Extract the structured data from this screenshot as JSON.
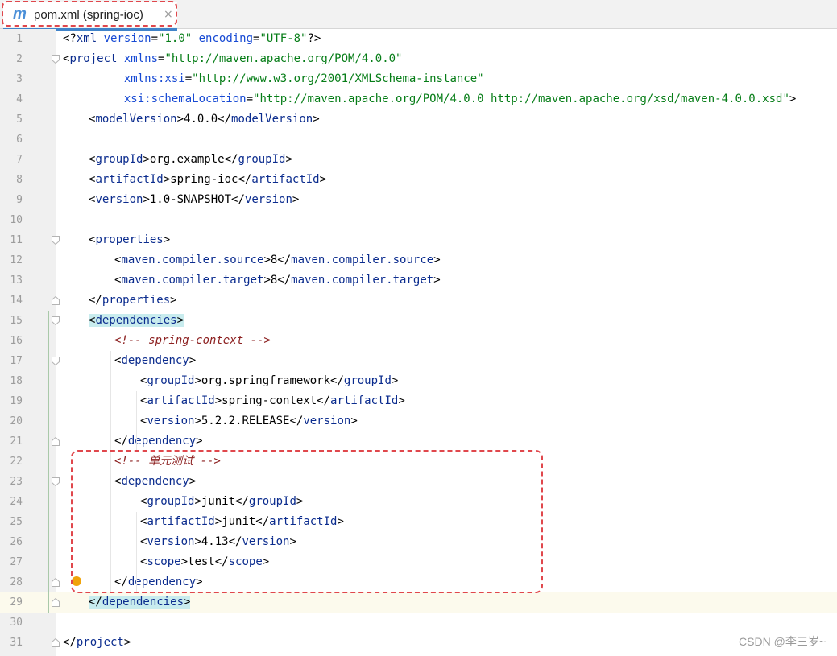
{
  "tab": {
    "icon_glyph": "m",
    "title": "pom.xml (spring-ioc)",
    "close_glyph": "×"
  },
  "editor": {
    "lines": [
      {
        "n": "1",
        "indent": 0,
        "parts": [
          [
            "pi",
            "<?"
          ],
          [
            "tag",
            "xml "
          ],
          [
            "attr",
            "version"
          ],
          [
            "pi",
            "="
          ],
          [
            "str",
            "\"1.0\" "
          ],
          [
            "attr",
            "encoding"
          ],
          [
            "pi",
            "="
          ],
          [
            "str",
            "\"UTF-8\""
          ],
          [
            "pi",
            "?>"
          ]
        ]
      },
      {
        "n": "2",
        "indent": 0,
        "fold": "open",
        "parts": [
          [
            "pi",
            "<"
          ],
          [
            "tag",
            "project "
          ],
          [
            "attr",
            "xmlns"
          ],
          [
            "pi",
            "="
          ],
          [
            "str",
            "\"http://maven.apache.org/POM/4.0.0\""
          ]
        ]
      },
      {
        "n": "3",
        "indent": 0,
        "parts": [
          [
            "pi",
            "         "
          ],
          [
            "attr",
            "xmlns:xsi"
          ],
          [
            "pi",
            "="
          ],
          [
            "str",
            "\"http://www.w3.org/2001/XMLSchema-instance\""
          ]
        ]
      },
      {
        "n": "4",
        "indent": 0,
        "parts": [
          [
            "pi",
            "         "
          ],
          [
            "attr",
            "xsi:schemaLocation"
          ],
          [
            "pi",
            "="
          ],
          [
            "str",
            "\"http://maven.apache.org/POM/4.0.0 http://maven.apache.org/xsd/maven-4.0.0.xsd\""
          ],
          [
            "pi",
            ">"
          ]
        ]
      },
      {
        "n": "5",
        "indent": 1,
        "parts": [
          [
            "pi",
            "<"
          ],
          [
            "tag",
            "modelVersion"
          ],
          [
            "pi",
            ">4.0.0</"
          ],
          [
            "tag",
            "modelVersion"
          ],
          [
            "pi",
            ">"
          ]
        ]
      },
      {
        "n": "6",
        "indent": 0,
        "parts": []
      },
      {
        "n": "7",
        "indent": 1,
        "parts": [
          [
            "pi",
            "<"
          ],
          [
            "tag",
            "groupId"
          ],
          [
            "pi",
            ">org.example</"
          ],
          [
            "tag",
            "groupId"
          ],
          [
            "pi",
            ">"
          ]
        ]
      },
      {
        "n": "8",
        "indent": 1,
        "parts": [
          [
            "pi",
            "<"
          ],
          [
            "tag",
            "artifactId"
          ],
          [
            "pi",
            ">spring-ioc</"
          ],
          [
            "tag",
            "artifactId"
          ],
          [
            "pi",
            ">"
          ]
        ]
      },
      {
        "n": "9",
        "indent": 1,
        "parts": [
          [
            "pi",
            "<"
          ],
          [
            "tag",
            "version"
          ],
          [
            "pi",
            ">1.0-SNAPSHOT</"
          ],
          [
            "tag",
            "version"
          ],
          [
            "pi",
            ">"
          ]
        ]
      },
      {
        "n": "10",
        "indent": 0,
        "parts": []
      },
      {
        "n": "11",
        "indent": 1,
        "fold": "open",
        "parts": [
          [
            "pi",
            "<"
          ],
          [
            "tag",
            "properties"
          ],
          [
            "pi",
            ">"
          ]
        ]
      },
      {
        "n": "12",
        "indent": 2,
        "parts": [
          [
            "pi",
            "<"
          ],
          [
            "tag",
            "maven.compiler.source"
          ],
          [
            "pi",
            ">8</"
          ],
          [
            "tag",
            "maven.compiler.source"
          ],
          [
            "pi",
            ">"
          ]
        ]
      },
      {
        "n": "13",
        "indent": 2,
        "parts": [
          [
            "pi",
            "<"
          ],
          [
            "tag",
            "maven.compiler.target"
          ],
          [
            "pi",
            ">8</"
          ],
          [
            "tag",
            "maven.compiler.target"
          ],
          [
            "pi",
            ">"
          ]
        ]
      },
      {
        "n": "14",
        "indent": 1,
        "fold": "close",
        "parts": [
          [
            "pi",
            "</"
          ],
          [
            "tag",
            "properties"
          ],
          [
            "pi",
            ">"
          ]
        ]
      },
      {
        "n": "15",
        "indent": 1,
        "fold": "open",
        "parts": [
          [
            "hlpi",
            "<"
          ],
          [
            "hltag",
            "dependencies"
          ],
          [
            "hlpi",
            ">"
          ]
        ]
      },
      {
        "n": "16",
        "indent": 2,
        "parts": [
          [
            "cmt",
            "<!-- spring-context -->"
          ]
        ]
      },
      {
        "n": "17",
        "indent": 2,
        "fold": "open",
        "parts": [
          [
            "pi",
            "<"
          ],
          [
            "tag",
            "dependency"
          ],
          [
            "pi",
            ">"
          ]
        ]
      },
      {
        "n": "18",
        "indent": 3,
        "parts": [
          [
            "pi",
            "<"
          ],
          [
            "tag",
            "groupId"
          ],
          [
            "pi",
            ">org.springframework</"
          ],
          [
            "tag",
            "groupId"
          ],
          [
            "pi",
            ">"
          ]
        ]
      },
      {
        "n": "19",
        "indent": 3,
        "parts": [
          [
            "pi",
            "<"
          ],
          [
            "tag",
            "artifactId"
          ],
          [
            "pi",
            ">spring-context</"
          ],
          [
            "tag",
            "artifactId"
          ],
          [
            "pi",
            ">"
          ]
        ]
      },
      {
        "n": "20",
        "indent": 3,
        "parts": [
          [
            "pi",
            "<"
          ],
          [
            "tag",
            "version"
          ],
          [
            "pi",
            ">5.2.2.RELEASE</"
          ],
          [
            "tag",
            "version"
          ],
          [
            "pi",
            ">"
          ]
        ]
      },
      {
        "n": "21",
        "indent": 2,
        "fold": "close",
        "parts": [
          [
            "pi",
            "</"
          ],
          [
            "tag",
            "dependency"
          ],
          [
            "pi",
            ">"
          ]
        ]
      },
      {
        "n": "22",
        "indent": 2,
        "parts": [
          [
            "cmt",
            "<!-- 单元测试 -->"
          ]
        ]
      },
      {
        "n": "23",
        "indent": 2,
        "fold": "open",
        "parts": [
          [
            "pi",
            "<"
          ],
          [
            "tag",
            "dependency"
          ],
          [
            "pi",
            ">"
          ]
        ]
      },
      {
        "n": "24",
        "indent": 3,
        "parts": [
          [
            "pi",
            "<"
          ],
          [
            "tag",
            "groupId"
          ],
          [
            "pi",
            ">junit</"
          ],
          [
            "tag",
            "groupId"
          ],
          [
            "pi",
            ">"
          ]
        ]
      },
      {
        "n": "25",
        "indent": 3,
        "parts": [
          [
            "pi",
            "<"
          ],
          [
            "tag",
            "artifactId"
          ],
          [
            "pi",
            ">junit</"
          ],
          [
            "tag",
            "artifactId"
          ],
          [
            "pi",
            ">"
          ]
        ]
      },
      {
        "n": "26",
        "indent": 3,
        "parts": [
          [
            "pi",
            "<"
          ],
          [
            "tag",
            "version"
          ],
          [
            "pi",
            ">4.13</"
          ],
          [
            "tag",
            "version"
          ],
          [
            "pi",
            ">"
          ]
        ]
      },
      {
        "n": "27",
        "indent": 3,
        "parts": [
          [
            "pi",
            "<"
          ],
          [
            "tag",
            "scope"
          ],
          [
            "pi",
            ">test</"
          ],
          [
            "tag",
            "scope"
          ],
          [
            "pi",
            ">"
          ]
        ]
      },
      {
        "n": "28",
        "indent": 2,
        "fold": "close",
        "parts": [
          [
            "pi",
            "</"
          ],
          [
            "tag",
            "dependency"
          ],
          [
            "pi",
            ">"
          ]
        ]
      },
      {
        "n": "29",
        "indent": 1,
        "fold": "close",
        "current": true,
        "parts": [
          [
            "hlpi",
            "</"
          ],
          [
            "hltag",
            "dependencies"
          ],
          [
            "hlpi",
            ">"
          ]
        ]
      },
      {
        "n": "30",
        "indent": 0,
        "parts": []
      },
      {
        "n": "31",
        "indent": 0,
        "fold": "close",
        "parts": [
          [
            "pi",
            "</"
          ],
          [
            "tag",
            "project"
          ],
          [
            "pi",
            ">"
          ]
        ]
      }
    ]
  },
  "watermark": "CSDN @李三岁~",
  "colors": {
    "tag": "#0b2c8e",
    "attribute": "#174ad4",
    "string": "#067d17",
    "comment": "#8c2020",
    "brace_highlight": "#c8ecee",
    "annotation": "#e0474c"
  }
}
